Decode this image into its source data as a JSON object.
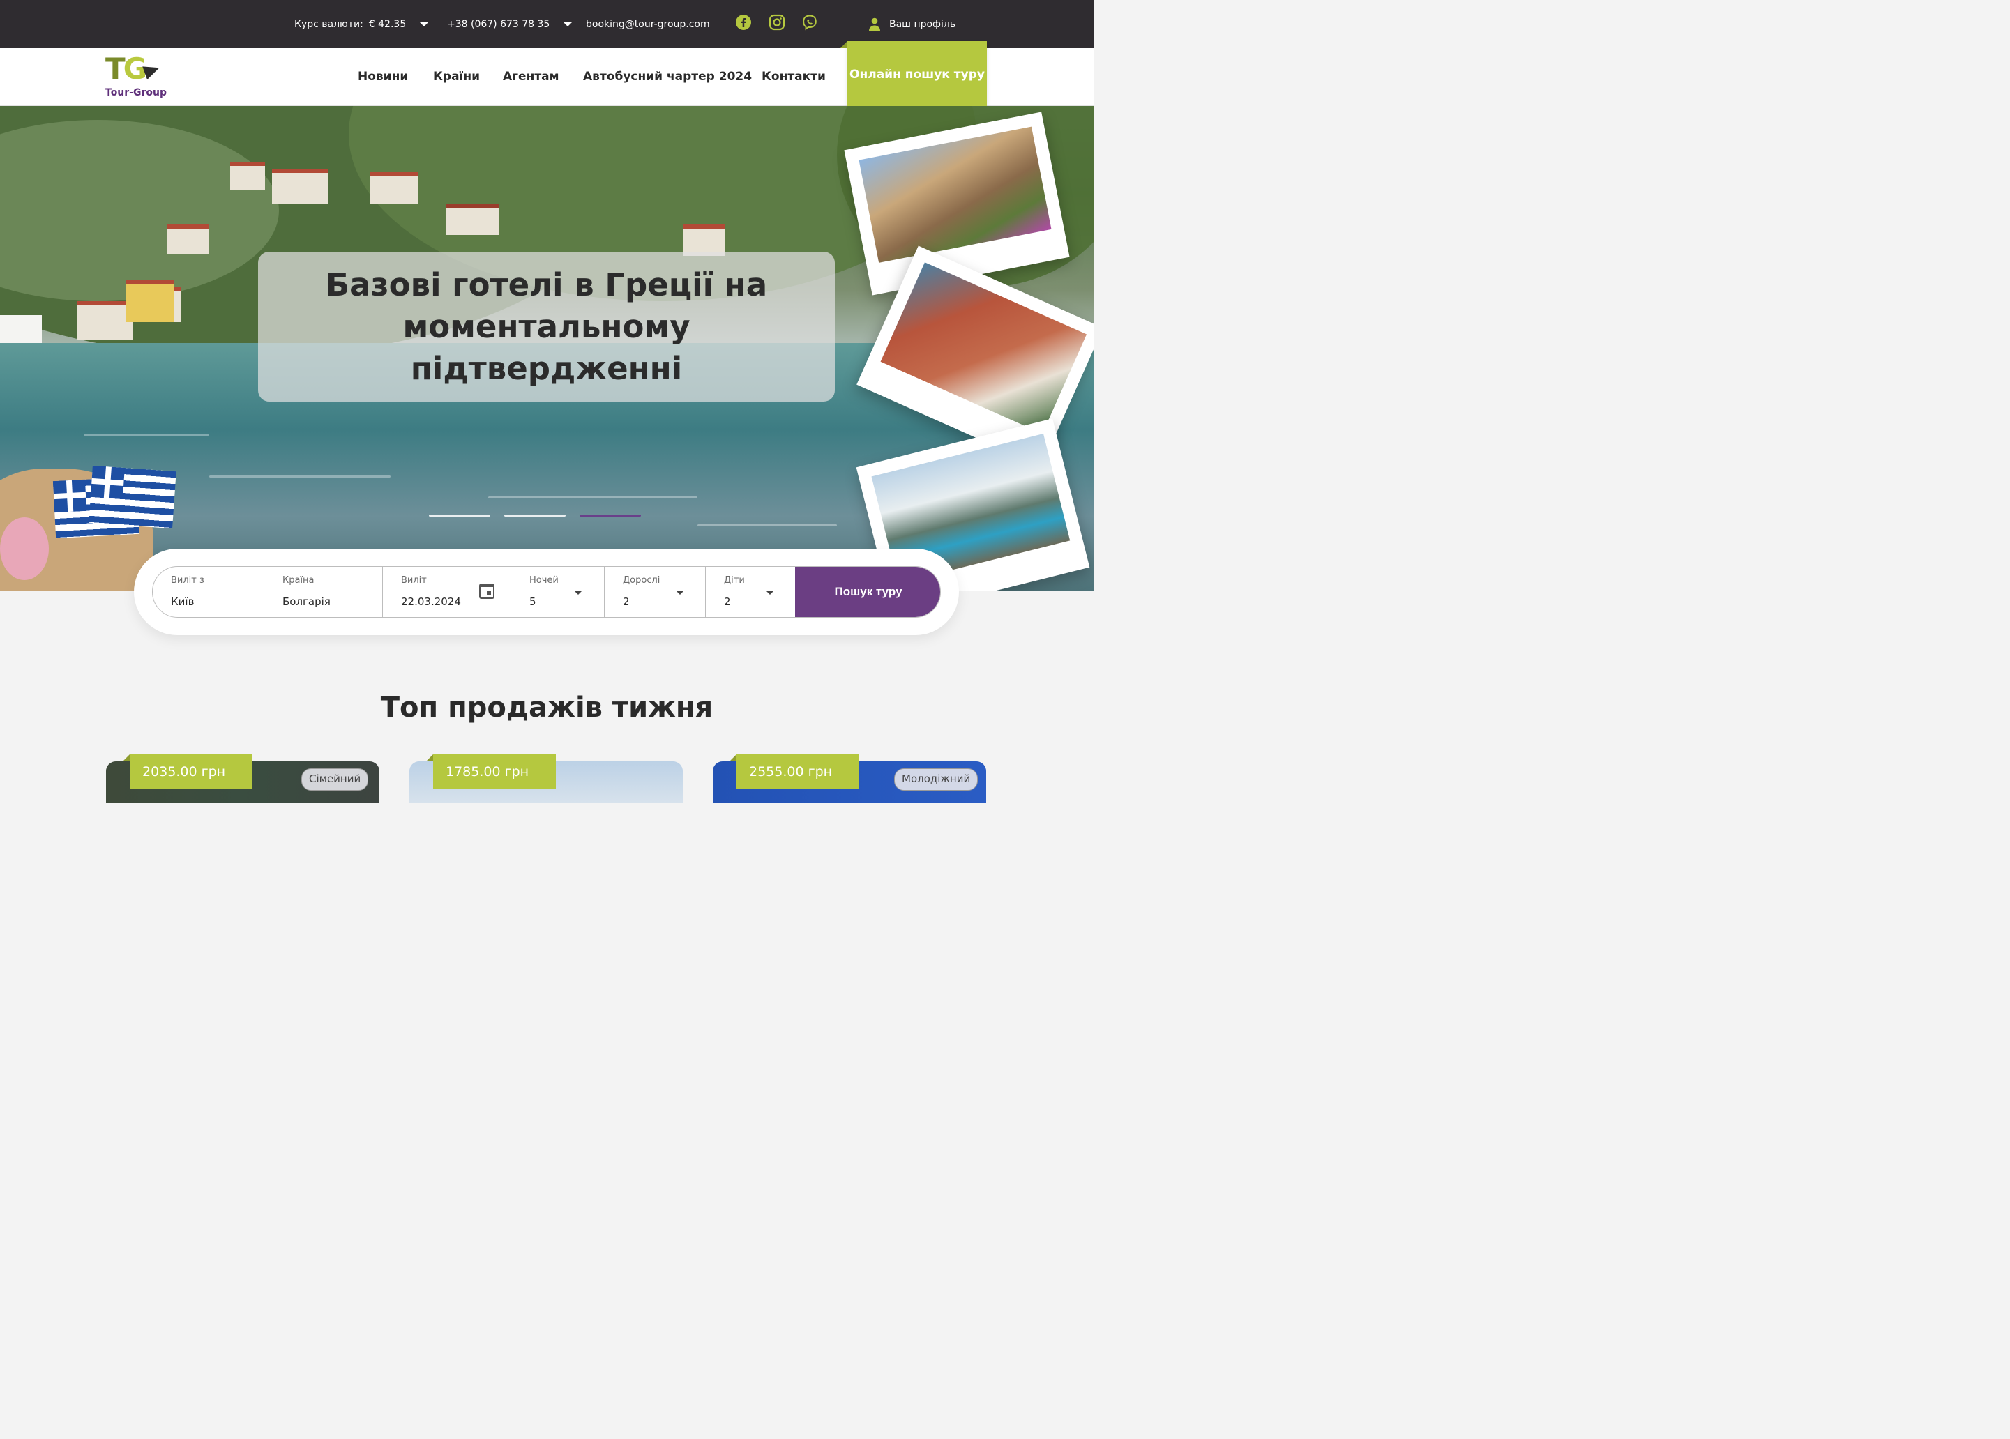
{
  "topbar": {
    "currency_label": "Курс валюти:",
    "currency_value": "€ 42.35",
    "phone": "+38 (067) 673 78 35",
    "email": "booking@tour-group.com",
    "profile": "Ваш профіль",
    "socials": [
      "facebook-icon",
      "instagram-icon",
      "viber-icon"
    ]
  },
  "brand": {
    "logo_mark": "TG",
    "name": "Tour-Group"
  },
  "nav": {
    "items": [
      "Новини",
      "Країни",
      "Агентам",
      "Автобусний чартер 2024",
      "Контакти"
    ],
    "cta": "Онлайн пошук туру"
  },
  "hero": {
    "title": "Базові готелі в Греції на моментальному підтвердженні",
    "slides": 3,
    "active_slide": 3
  },
  "search": {
    "fields": [
      {
        "label": "Виліт з",
        "value": "Київ"
      },
      {
        "label": "Країна",
        "value": "Болгарія"
      },
      {
        "label": "Виліт",
        "value": "22.03.2024"
      },
      {
        "label": "Ночей",
        "value": "5"
      },
      {
        "label": "Дорослі",
        "value": "2"
      },
      {
        "label": "Діти",
        "value": "2"
      }
    ],
    "button": "Пошук туру"
  },
  "top_sales": {
    "title": "Топ продажів тижня",
    "cards": [
      {
        "price": "2035.00 грн",
        "tag": "Сімейний"
      },
      {
        "price": "1785.00 грн",
        "tag": ""
      },
      {
        "price": "2555.00 грн",
        "tag": "Молодіжний"
      }
    ]
  },
  "colors": {
    "topbar_bg": "#2f2c30",
    "accent_green": "#b5c83f",
    "accent_purple": "#6b3e83"
  }
}
